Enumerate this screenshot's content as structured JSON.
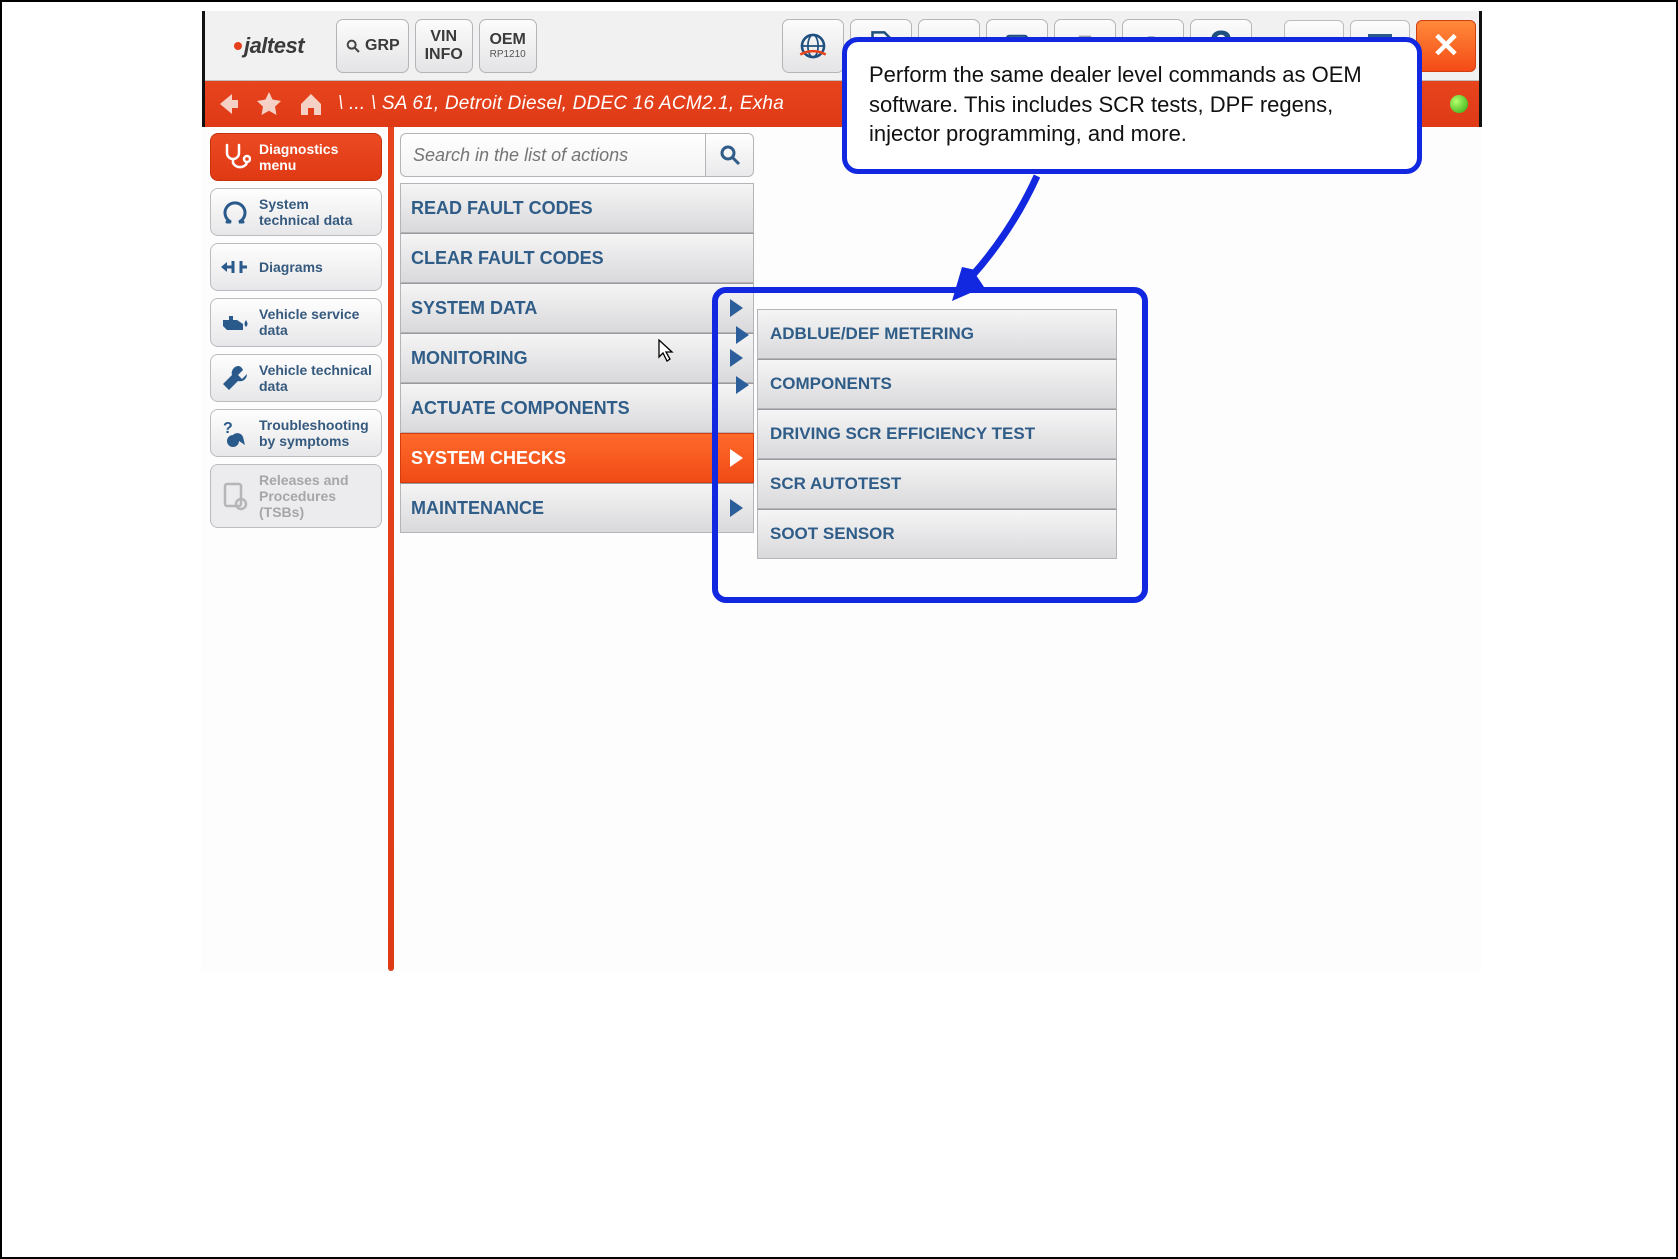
{
  "colors": {
    "accent": "#e7441e",
    "accent_dark": "#df3a16",
    "link": "#2f5d88",
    "annotation": "#1128e0"
  },
  "logo": {
    "text": "jaltest"
  },
  "toolbar": {
    "grp_label": "GRP",
    "vin_label_l1": "VIN",
    "vin_label_l2": "INFO",
    "oem_label_l1": "OEM",
    "oem_label_l2": "RP1210"
  },
  "breadcrumb": {
    "text": "\\ ... \\ SA 61, Detroit Diesel, DDEC 16 ACM2.1, Exha"
  },
  "sidebar": {
    "items": [
      {
        "label": "Diagnostics menu",
        "active": true
      },
      {
        "label": "System technical data"
      },
      {
        "label": "Diagrams"
      },
      {
        "label": "Vehicle service data"
      },
      {
        "label": "Vehicle technical data"
      },
      {
        "label": "Troubleshooting by symptoms"
      },
      {
        "label": "Releases and Procedures (TSBs)",
        "disabled": true
      }
    ]
  },
  "search": {
    "placeholder": "Search in the list of actions"
  },
  "actions": [
    {
      "label": "READ FAULT CODES",
      "expand": false
    },
    {
      "label": "CLEAR FAULT CODES",
      "expand": false
    },
    {
      "label": "SYSTEM DATA",
      "expand": true
    },
    {
      "label": "MONITORING",
      "expand": true
    },
    {
      "label": "ACTUATE COMPONENTS",
      "expand": false
    },
    {
      "label": "SYSTEM CHECKS",
      "expand": true,
      "selected": true
    },
    {
      "label": "MAINTENANCE",
      "expand": true
    }
  ],
  "sub_actions": [
    {
      "label": "ADBLUE/DEF METERING",
      "expand": true
    },
    {
      "label": "COMPONENTS",
      "expand": true
    },
    {
      "label": "DRIVING SCR EFFICIENCY TEST",
      "expand": false
    },
    {
      "label": "SCR AUTOTEST",
      "expand": false
    },
    {
      "label": "SOOT SENSOR",
      "expand": false
    }
  ],
  "annotation": {
    "text": "Perform the same dealer level commands as OEM software. This includes SCR tests, DPF regens, injector programming, and more."
  }
}
